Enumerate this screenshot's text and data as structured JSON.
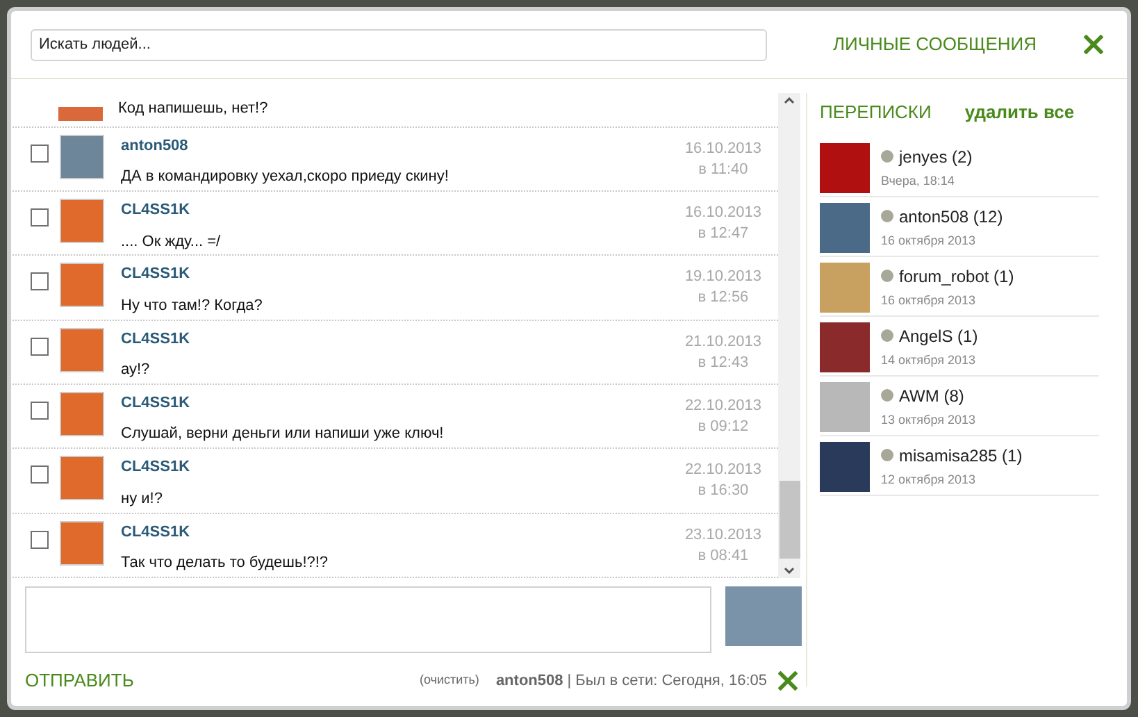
{
  "header": {
    "search": {
      "placeholder": "Искать людей..."
    },
    "title": "ЛИЧНЫЕ СООБЩЕНИЯ"
  },
  "messages": [
    {
      "kind": "partial",
      "text": "Код напишешь, нет!?"
    },
    {
      "kind": "full",
      "sender": "anton508",
      "text": "ДА в командировку уехал,скоро приеду скину!",
      "date": "16.10.2013",
      "time": "в 11:40",
      "checked": false
    },
    {
      "kind": "full",
      "sender": "CL4SS1K",
      "text": ".... Ок жду... =/",
      "date": "16.10.2013",
      "time": "в 12:47",
      "checked": false
    },
    {
      "kind": "full",
      "sender": "CL4SS1K",
      "text": "Ну что там!? Когда?",
      "date": "19.10.2013",
      "time": "в 12:56",
      "checked": false
    },
    {
      "kind": "full",
      "sender": "CL4SS1K",
      "text": "ау!?",
      "date": "21.10.2013",
      "time": "в 12:43",
      "checked": false
    },
    {
      "kind": "full",
      "sender": "CL4SS1K",
      "text": "Слушай, верни деньги или напиши уже ключ!",
      "date": "22.10.2013",
      "time": "в 09:12",
      "checked": false
    },
    {
      "kind": "full",
      "sender": "CL4SS1K",
      "text": "ну и!?",
      "date": "22.10.2013",
      "time": "в 16:30",
      "checked": false
    },
    {
      "kind": "full",
      "sender": "CL4SS1K",
      "text": "Так что делать то будешь!?!?",
      "date": "23.10.2013",
      "time": "в 08:41",
      "checked": false
    }
  ],
  "composer": {
    "send": "ОТПРАВИТЬ",
    "clear": "(очистить)",
    "user": "anton508",
    "status": "| Был в сети: Сегодня, 16:05"
  },
  "conversations": {
    "title": "ПЕРЕПИСКИ",
    "delete_all": "удалить все",
    "items": [
      {
        "name": "jenyes (2)",
        "date": "Вчера, 18:14"
      },
      {
        "name": "anton508 (12)",
        "date": "16 октября 2013"
      },
      {
        "name": "forum_robot (1)",
        "date": "16 октября 2013"
      },
      {
        "name": "AngelS (1)",
        "date": "14 октября 2013"
      },
      {
        "name": "AWM (8)",
        "date": "13 октября 2013"
      },
      {
        "name": "misamisa285 (1)",
        "date": "12 октября 2013"
      }
    ]
  }
}
